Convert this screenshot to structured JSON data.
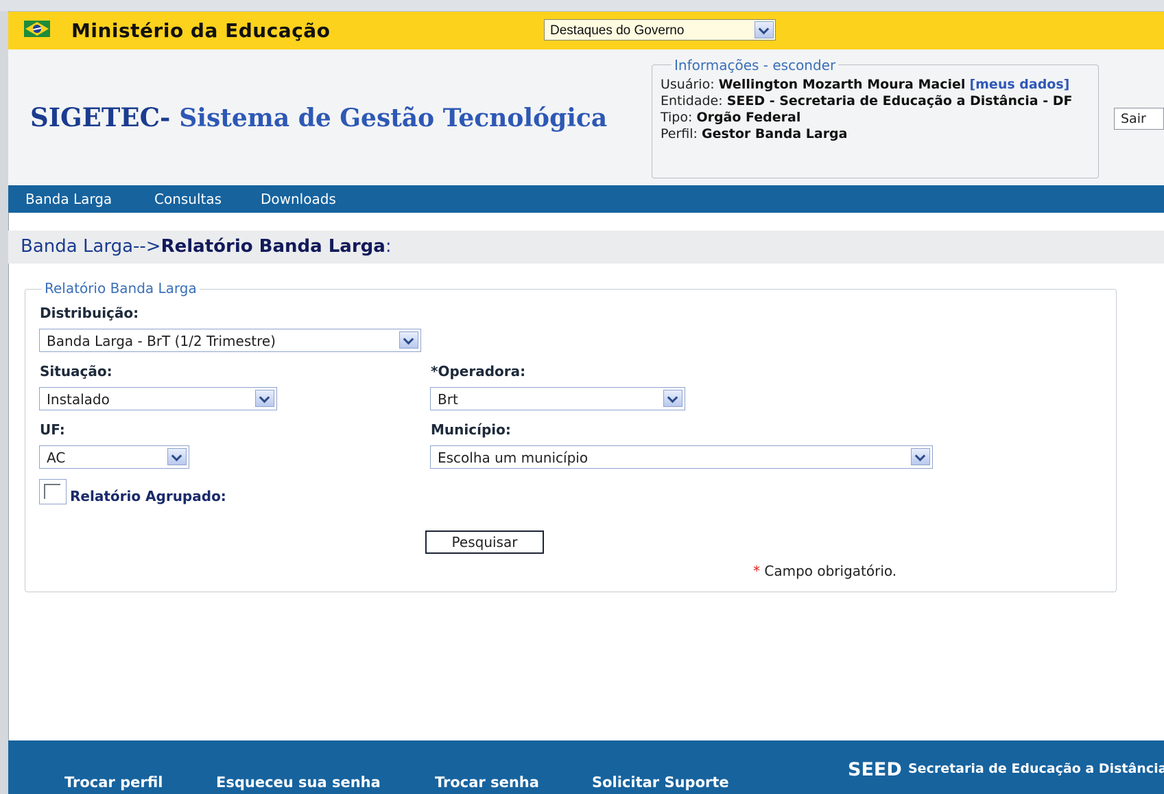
{
  "gov": {
    "title": "Ministério da Educação",
    "select_value": "Destaques do Governo"
  },
  "header": {
    "sys_prefix": "SIGETEC-",
    "sys_name": "Sistema de Gestão Tecnológica",
    "info_legend": "Informações - esconder",
    "user_label": "Usuário:",
    "user_name": "Wellington Mozarth Moura Maciel",
    "user_link": "[meus dados]",
    "entity_label": "Entidade:",
    "entity_value": "SEED - Secretaria de Educação a Distância - DF",
    "type_label": "Tipo:",
    "type_value": "Orgão Federal",
    "profile_label": "Perfil:",
    "profile_value": "Gestor Banda Larga",
    "logout": "Sair"
  },
  "nav": {
    "items": [
      "Banda Larga",
      "Consultas",
      "Downloads"
    ]
  },
  "breadcrumb": {
    "parent": "Banda Larga-->",
    "current": "Relatório Banda Larga",
    "suffix": ":"
  },
  "form": {
    "legend": "Relatório Banda Larga",
    "distribution_label": "Distribuição:",
    "distribution_value": "Banda Larga - BrT (1/2 Trimestre)",
    "situation_label": "Situação:",
    "situation_value": "Instalado",
    "operator_label": "*Operadora:",
    "operator_value": "Brt",
    "uf_label": "UF:",
    "uf_value": "AC",
    "municipality_label": "Município:",
    "municipality_value": "Escolha um município",
    "grouped_label": "Relatório Agrupado:",
    "search_button": "Pesquisar",
    "required_star": "*",
    "required_text": "Campo obrigatório."
  },
  "footer": {
    "links": [
      "Trocar perfil",
      "Esqueceu sua senha",
      "Trocar senha",
      "Solicitar Suporte"
    ],
    "seed": "SEED",
    "seed_text": "Secretaria de Educação a Distância"
  },
  "colors": {
    "gov_bar": "#fdd21d",
    "nav_blue": "#17639e",
    "title_blue": "#1a3c8f"
  }
}
